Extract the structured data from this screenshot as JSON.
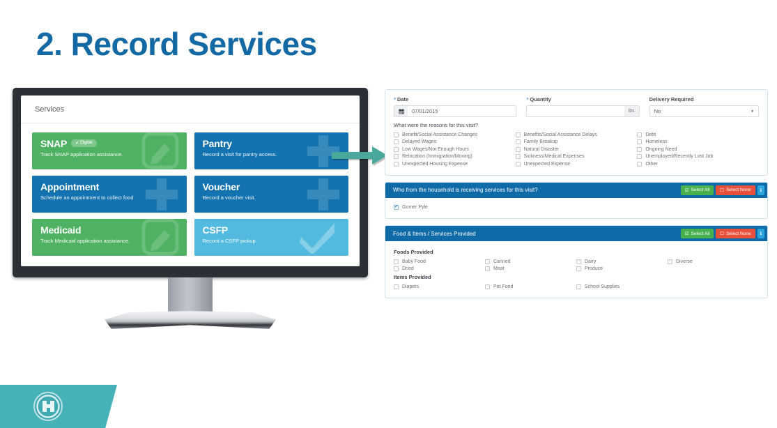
{
  "slide": {
    "title": "2. Record Services",
    "title_color": "#1369a3"
  },
  "monitor": {
    "screen_header_title": "Services",
    "tiles": [
      {
        "name": "SNAP",
        "desc": "Track SNAP application assistance.",
        "badge": "Eligible",
        "badge_icon": "check-icon",
        "icon": "pencil-icon",
        "color": "green"
      },
      {
        "name": "Pantry",
        "desc": "Record a visit for pantry access.",
        "badge": "",
        "badge_icon": "",
        "icon": "plus-icon",
        "color": "blue"
      },
      {
        "name": "Appointment",
        "desc": "Schedule an appointment to collect food",
        "badge": "",
        "badge_icon": "",
        "icon": "plus-icon",
        "color": "blue"
      },
      {
        "name": "Voucher",
        "desc": "Record a voucher visit.",
        "badge": "",
        "badge_icon": "",
        "icon": "plus-icon",
        "color": "blue"
      },
      {
        "name": "Medicaid",
        "desc": "Track Medicaid application assistance.",
        "badge": "",
        "badge_icon": "",
        "icon": "pencil-icon",
        "color": "green"
      },
      {
        "name": "CSFP",
        "desc": "Record a CSFP pickup",
        "badge": "",
        "badge_icon": "",
        "icon": "check-icon",
        "color": "lightblue"
      }
    ],
    "colors": {
      "green": "#4fb263",
      "blue": "#1273b0",
      "lightblue": "#52bade",
      "bezel": "#2b2f36"
    }
  },
  "arrow": {
    "name": "callout-arrow",
    "color": "#4aa79b"
  },
  "form": {
    "date": {
      "label": "Date",
      "required": true,
      "value": "07/01/2015",
      "icon": "calendar-icon"
    },
    "quantity": {
      "label": "Quantity",
      "required": true,
      "value": "",
      "unit": "lbs"
    },
    "delivery": {
      "label": "Delivery Required",
      "required": false,
      "value": "No"
    },
    "reasons_question": "What were the reasons for this visit?",
    "reasons_columns": [
      [
        "Benefit/Social Assistance Changes",
        "Delayed Wages",
        "Low Wages/Not Enough Hours",
        "Relocation (Immigration/Moving)",
        "Unexpected Housing Expense"
      ],
      [
        "Benefits/Social Assistance Delays",
        "Family Breakup",
        "Natural Disaster",
        "Sickness/Medical Expenses",
        "Unexpected Expense"
      ],
      [
        "Debt",
        "Homeless",
        "Ongoing Need",
        "Unemployed/Recently Lost Job",
        "Other"
      ]
    ],
    "household": {
      "title": "Who from the household is receiving services for this visit?",
      "select_all": "Select All",
      "select_none": "Select None",
      "info_icon": "info-icon",
      "members": [
        {
          "name": "Gomer Pyle",
          "checked": true
        }
      ]
    },
    "provided": {
      "title": "Food & Items / Services Provided",
      "select_all": "Select All",
      "select_none": "Select None",
      "info_icon": "info-icon",
      "foods_title": "Foods Provided",
      "foods": [
        "Baby Food",
        "Canned",
        "Dairy",
        "Diverse",
        "Dried",
        "Meat",
        "Produce"
      ],
      "items_title": "Items Provided",
      "items": [
        "Diapers",
        "Pet Food",
        "School Supplies"
      ]
    },
    "colors": {
      "header": "#0f6aa8",
      "green_btn": "#48b14d",
      "red_btn": "#e8503c",
      "info_btn": "#2ba6dd"
    }
  },
  "banner": {
    "color": "#45b2b8",
    "logo_icon": "organization-logo-icon"
  }
}
